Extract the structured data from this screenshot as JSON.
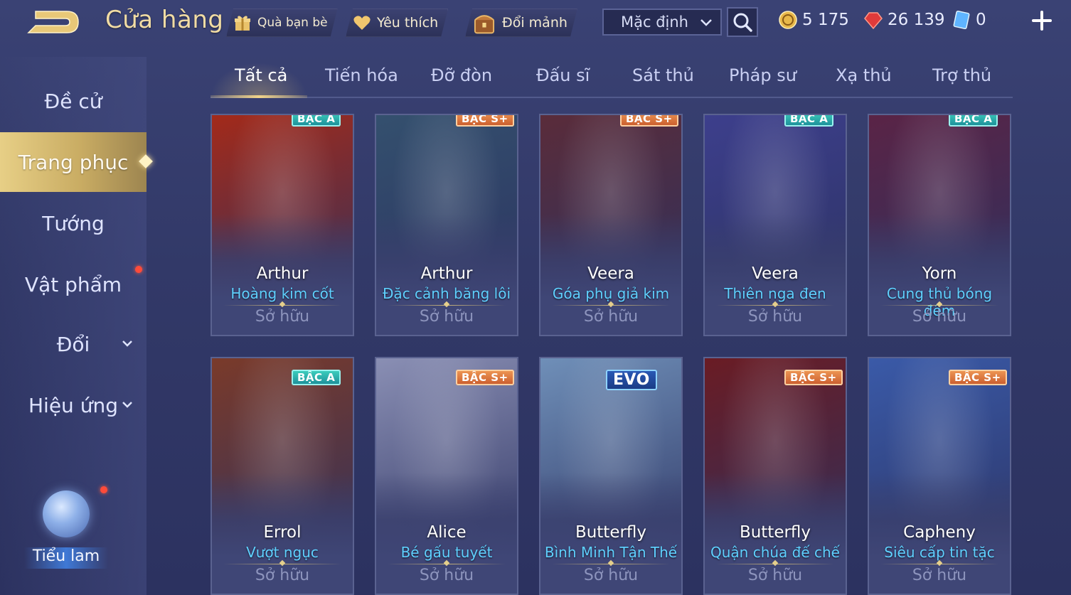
{
  "header": {
    "title": "Cửa hàng",
    "friend_gift_label": "Quà bạn bè",
    "favorite_label": "Yêu thích",
    "exchange_label": "Đổi mảnh",
    "sort_value": "Mặc định",
    "currencies": [
      {
        "name": "gold",
        "value": "5 175",
        "icon": "gold-coin-icon"
      },
      {
        "name": "vouchers",
        "value": "26 139",
        "icon": "red-gem-icon"
      },
      {
        "name": "tokens",
        "value": "0",
        "icon": "blue-card-icon"
      }
    ]
  },
  "sidebar": {
    "items": [
      {
        "label": "Đề cử"
      },
      {
        "label": "Trang phục",
        "active": true
      },
      {
        "label": "Tướng"
      },
      {
        "label": "Vật phẩm",
        "notification": true
      },
      {
        "label": "Đổi",
        "expandable": true
      },
      {
        "label": "Hiệu ứng",
        "expandable": true
      }
    ],
    "mascot_label": "Tiểu lam"
  },
  "tabs": [
    "Tất cả",
    "Tiến hóa",
    "Đỡ đòn",
    "Đấu sĩ",
    "Sát thủ",
    "Pháp sư",
    "Xạ thủ",
    "Trợ thủ"
  ],
  "active_tab": "Tất cả",
  "cards": [
    {
      "hero": "Arthur",
      "skin": "Hoàng kim cốt",
      "tier": "BẬC A",
      "status": "Sở hữu",
      "accent": "#a32a1a"
    },
    {
      "hero": "Arthur",
      "skin": "Đặc cảnh băng lôi",
      "tier": "BẬC S+",
      "status": "Sở hữu",
      "accent": "#34506e"
    },
    {
      "hero": "Veera",
      "skin": "Góa phụ giả kim",
      "tier": "BẬC S+",
      "status": "Sở hữu",
      "accent": "#5a2c3a"
    },
    {
      "hero": "Veera",
      "skin": "Thiên nga đen",
      "tier": "BẬC A",
      "status": "Sở hữu",
      "accent": "#3d3f8c"
    },
    {
      "hero": "Yorn",
      "skin": "Cung thủ bóng đêm",
      "tier": "BẬC A",
      "status": "Sở hữu",
      "accent": "#5a2446"
    },
    {
      "hero": "Errol",
      "skin": "Vượt ngục",
      "tier": "BẬC A",
      "status": "Sở hữu",
      "accent": "#7a3a2a"
    },
    {
      "hero": "Alice",
      "skin": "Bé gấu tuyết",
      "tier": "BẬC S+",
      "status": "Sở hữu",
      "accent": "#8a8fb4"
    },
    {
      "hero": "Butterfly",
      "skin": "Bình Minh Tận Thế",
      "tier": "EVO",
      "status": "Sở hữu",
      "accent": "#6f8fb8"
    },
    {
      "hero": "Butterfly",
      "skin": "Quận chúa đế chế",
      "tier": "BẬC S+",
      "status": "Sở hữu",
      "accent": "#6a1c24"
    },
    {
      "hero": "Capheny",
      "skin": "Siêu cấp tin tặc",
      "tier": "BẬC S+",
      "status": "Sở hữu",
      "accent": "#3a5aa8"
    }
  ],
  "colors": {
    "background": "#343b6c",
    "gold_accent": "#e7cf86",
    "skin_name": "#5fd0ff",
    "owned_text": "#8d94bd"
  }
}
